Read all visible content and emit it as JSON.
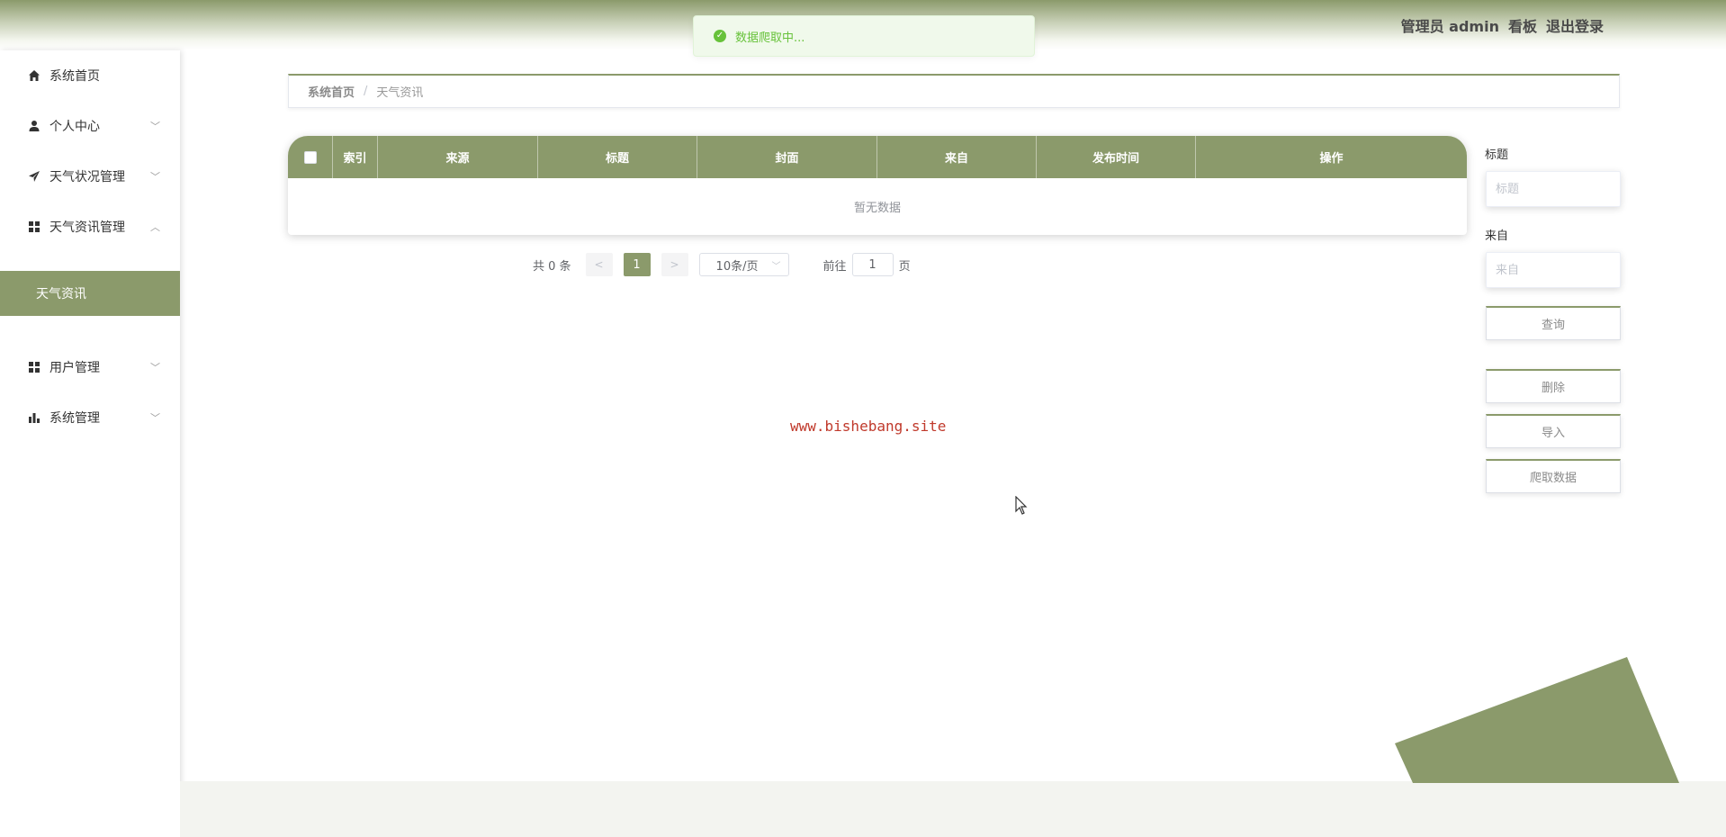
{
  "header": {
    "user_label": "管理员 admin",
    "dashboard_label": "看板",
    "logout_label": "退出登录"
  },
  "toast": {
    "message": "数据爬取中..."
  },
  "sidebar": {
    "items": [
      {
        "label": "系统首页",
        "icon": "home-icon"
      },
      {
        "label": "个人中心",
        "icon": "user-icon"
      },
      {
        "label": "天气状况管理",
        "icon": "send-icon"
      },
      {
        "label": "天气资讯管理",
        "icon": "grid-icon"
      },
      {
        "label": "用户管理",
        "icon": "grid-icon"
      },
      {
        "label": "系统管理",
        "icon": "bar-chart-icon"
      }
    ],
    "active_subitem": "天气资讯"
  },
  "breadcrumb": {
    "home": "系统首页",
    "separator": "/",
    "current": "天气资讯"
  },
  "table": {
    "columns": [
      "索引",
      "来源",
      "标题",
      "封面",
      "来自",
      "发布时间",
      "操作"
    ],
    "empty_text": "暂无数据"
  },
  "pagination": {
    "total": "共 0 条",
    "prev": "<",
    "current_page": "1",
    "next": ">",
    "page_size": "10条/页",
    "goto_label": "前往",
    "goto_value": "1",
    "page_suffix": "页"
  },
  "search": {
    "title_label": "标题",
    "title_placeholder": "标题",
    "source_label": "来自",
    "source_placeholder": "来自",
    "query_button": "查询",
    "delete_button": "删除",
    "import_button": "导入",
    "crawl_button": "爬取数据"
  },
  "watermark": "www.bishebang.site",
  "colors": {
    "accent": "#8b9a6b",
    "success": "#67c23a",
    "watermark": "#c0392b"
  }
}
